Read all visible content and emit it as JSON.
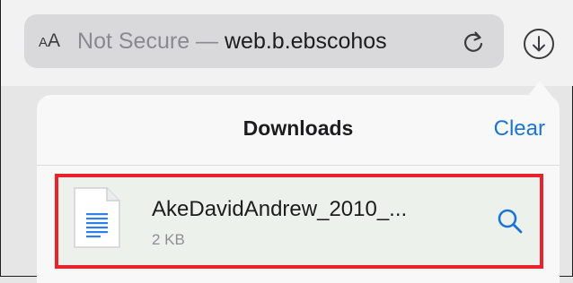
{
  "url_bar": {
    "text_size_label": "AA",
    "security_label": "Not Secure — ",
    "domain": "web.b.ebscohos"
  },
  "downloads": {
    "title": "Downloads",
    "clear_label": "Clear",
    "items": [
      {
        "name": "AkeDavidAndrew_2010_...",
        "size": "2 KB"
      }
    ]
  },
  "colors": {
    "accent": "#1a74d8",
    "highlight_border": "#e8232b",
    "row_background": "#ecf1ec"
  }
}
